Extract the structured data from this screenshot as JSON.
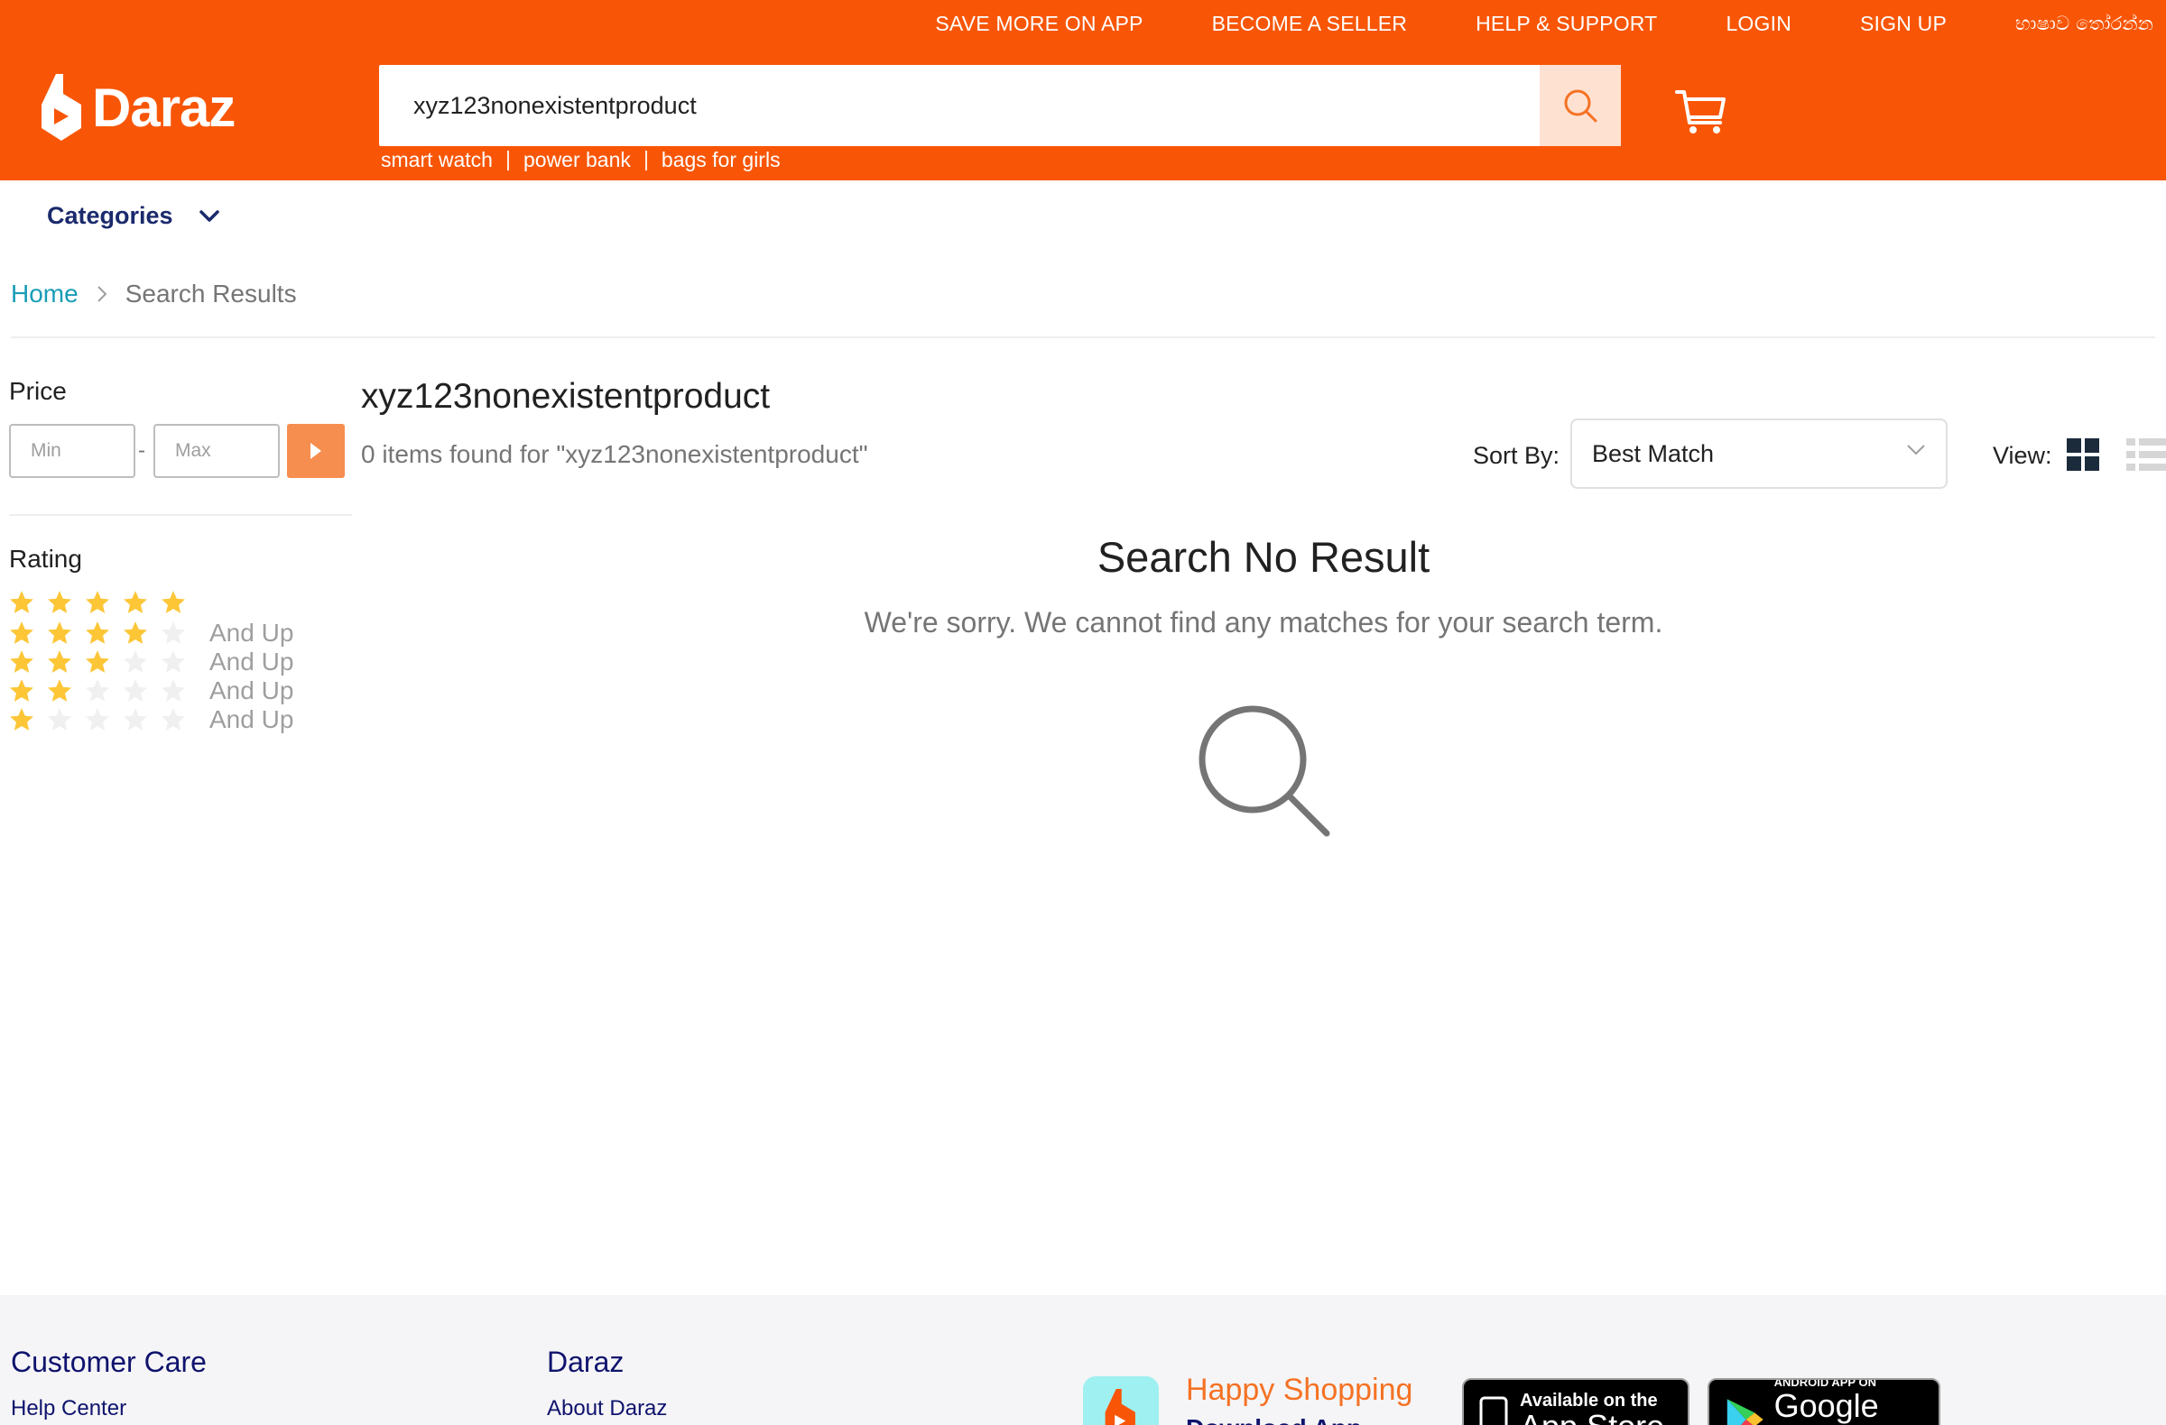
{
  "header": {
    "top_nav": [
      "SAVE MORE ON APP",
      "BECOME A SELLER",
      "HELP & SUPPORT",
      "LOGIN",
      "SIGN UP",
      "භාෂාව තෝරන්න"
    ],
    "logo_text": "Daraz",
    "search_value": "xyz123nonexistentproduct",
    "hot_keywords": [
      "smart watch",
      "power bank",
      "bags for girls"
    ],
    "brand_color": "#f85606"
  },
  "categories_label": "Categories",
  "breadcrumb": {
    "home": "Home",
    "current": "Search Results"
  },
  "sidebar": {
    "price_title": "Price",
    "min_placeholder": "Min",
    "max_placeholder": "Max",
    "dash": "-",
    "rating_title": "Rating",
    "ratings": [
      {
        "stars": 5,
        "label": ""
      },
      {
        "stars": 4,
        "label": "And Up"
      },
      {
        "stars": 3,
        "label": "And Up"
      },
      {
        "stars": 2,
        "label": "And Up"
      },
      {
        "stars": 1,
        "label": "And Up"
      }
    ]
  },
  "results": {
    "query_title": "xyz123nonexistentproduct",
    "count_text": "0 items found for \"xyz123nonexistentproduct\"",
    "sort_label": "Sort By:",
    "sort_value": "Best Match",
    "view_label": "View:",
    "no_result_title": "Search No Result",
    "no_result_message": "We're sorry. We cannot find any matches for your search term."
  },
  "footer": {
    "customer_care_title": "Customer Care",
    "help_center": "Help Center",
    "daraz_title": "Daraz",
    "about_daraz": "About Daraz",
    "happy_shopping": "Happy Shopping",
    "download_app": "Download App",
    "app_store_small": "Available on the",
    "app_store_big": "App Store",
    "google_play_small": "ANDROID APP ON",
    "google_play_big": "Google play"
  }
}
